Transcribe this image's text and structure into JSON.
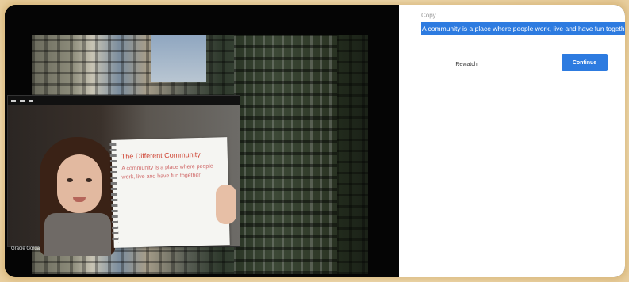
{
  "video": {
    "participant_name": "Gracie Gorda",
    "notebook": {
      "title": "The Different Community",
      "line1": "A community is a place where people",
      "line2": "work, live and have fun together"
    },
    "toolbar_icons": [
      "minimize-icon",
      "grid-icon",
      "menu-icon"
    ]
  },
  "panel": {
    "label": "Copy",
    "selected_text": "A community is a place where people work, live and have fun together",
    "rewatch_label": "Rewatch",
    "continue_label": "Continue"
  },
  "colors": {
    "accent": "#2d7be0",
    "background_glow": "#f2dfb8"
  }
}
